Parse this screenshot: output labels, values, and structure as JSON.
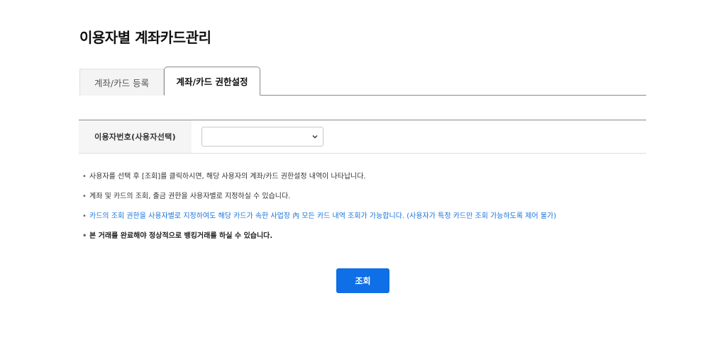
{
  "page": {
    "title": "이용자별 계좌카드관리"
  },
  "tabs": [
    {
      "label": "계좌/카드 등록",
      "active": false
    },
    {
      "label": "계좌/카드 권한설정",
      "active": true
    }
  ],
  "form": {
    "user_label": "이용자번호(사용자선택)",
    "user_select_value": ""
  },
  "notes": [
    "사용자를 선택 후 [조회]를 클릭하시면, 해당 사용자의 계좌/카드 권한설정 내역이 나타납니다.",
    "계좌 및 카드의 조회, 출금 권한을 사용자별로 지정하실 수 있습니다.",
    "카드의 조회 권한을 사용자별로 지정하여도 해당 카드가 속한 사업장 內 모든 카드 내역 조회가 가능합니다. (사용자가 특정 카드만 조회 가능하도록 제어 불가)",
    "본 거래를 완료해야 정상적으로 뱅킹거래를 하실 수 있습니다."
  ],
  "bullet_char": "•",
  "buttons": {
    "search_label": "조회"
  },
  "colors": {
    "primary": "#0f6fe6",
    "note_blue": "#1a73d9"
  }
}
